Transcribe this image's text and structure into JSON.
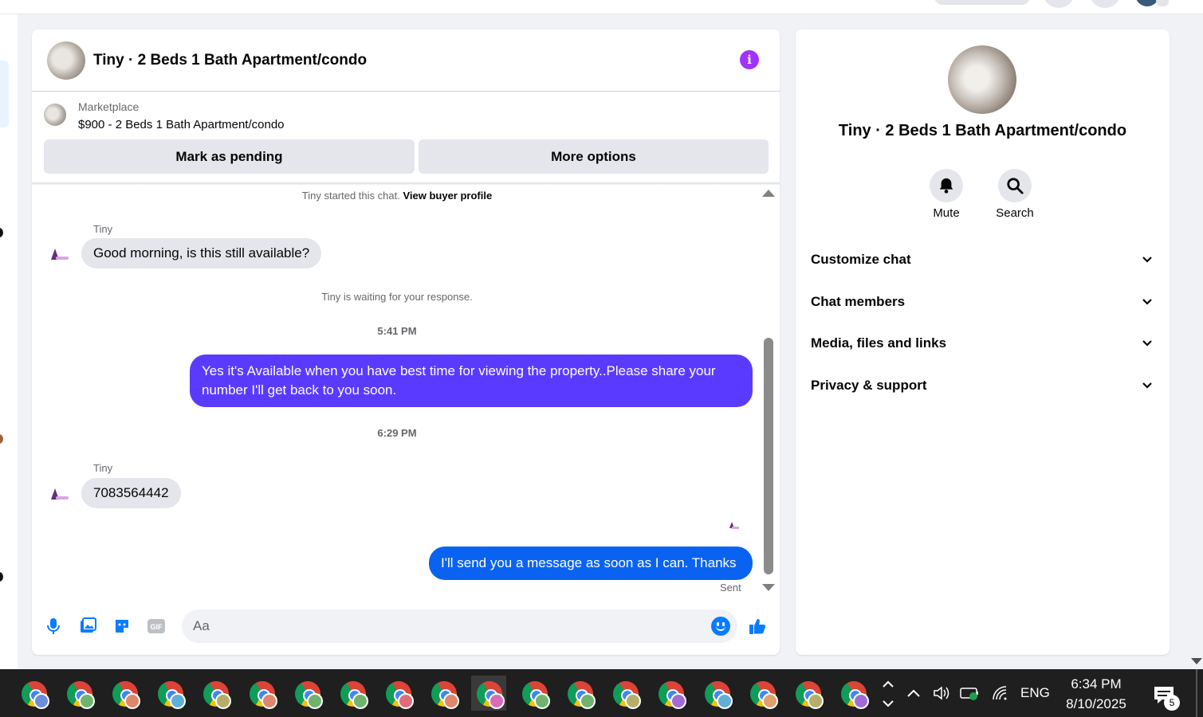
{
  "chat": {
    "title": "Tiny · 2 Beds 1 Bath Apartment/condo",
    "info_icon": "info-icon",
    "marketplace": {
      "label": "Marketplace",
      "listing": "$900 - 2 Beds 1 Bath Apartment/condo"
    },
    "actions": {
      "pending": "Mark as pending",
      "more": "More options"
    },
    "started_text": "Tiny started this chat.",
    "view_buyer_profile": "View buyer profile",
    "messages": [
      {
        "from": "Tiny",
        "text": "Good morning, is this still available?"
      },
      {
        "system": "Tiny is waiting for your response."
      },
      {
        "timestamp": "5:41 PM"
      },
      {
        "from": "me",
        "text": "Yes it's Available when you have best time for viewing the property..Please share your number I'll get back to you soon."
      },
      {
        "timestamp": "6:29 PM"
      },
      {
        "from": "Tiny",
        "text": "7083564442"
      },
      {
        "from": "me",
        "text": "I'll send you a message as soon as I can. Thanks"
      }
    ],
    "status": "Sent",
    "composer": {
      "placeholder": "Aa"
    },
    "colors": {
      "accent": "#a033ff",
      "out_purple": "#5b3aff",
      "out_blue": "#0a63f0"
    }
  },
  "details": {
    "title": "Tiny · 2 Beds 1 Bath Apartment/condo",
    "mute": "Mute",
    "search": "Search",
    "sections": [
      "Customize chat",
      "Chat members",
      "Media, files and links",
      "Privacy & support"
    ]
  },
  "taskbar": {
    "badge_colors": [
      "#6a8fd8",
      "#6fb36f",
      "#e0866b",
      "#5fb0d8",
      "#b7ad6b",
      "#e0866b",
      "#6fb36f",
      "#6fb36f",
      "#e06b7b",
      "#e0866b",
      "#d86bb8",
      "#6fb36f",
      "#6fb36f",
      "#b7ad6b",
      "#a06bd8",
      "#5fb0d8",
      "#e0a06b",
      "#b7ad6b",
      "#a06bd8"
    ],
    "language": "ENG",
    "time": "6:34 PM",
    "date": "8/10/2025",
    "notification_count": "5"
  }
}
